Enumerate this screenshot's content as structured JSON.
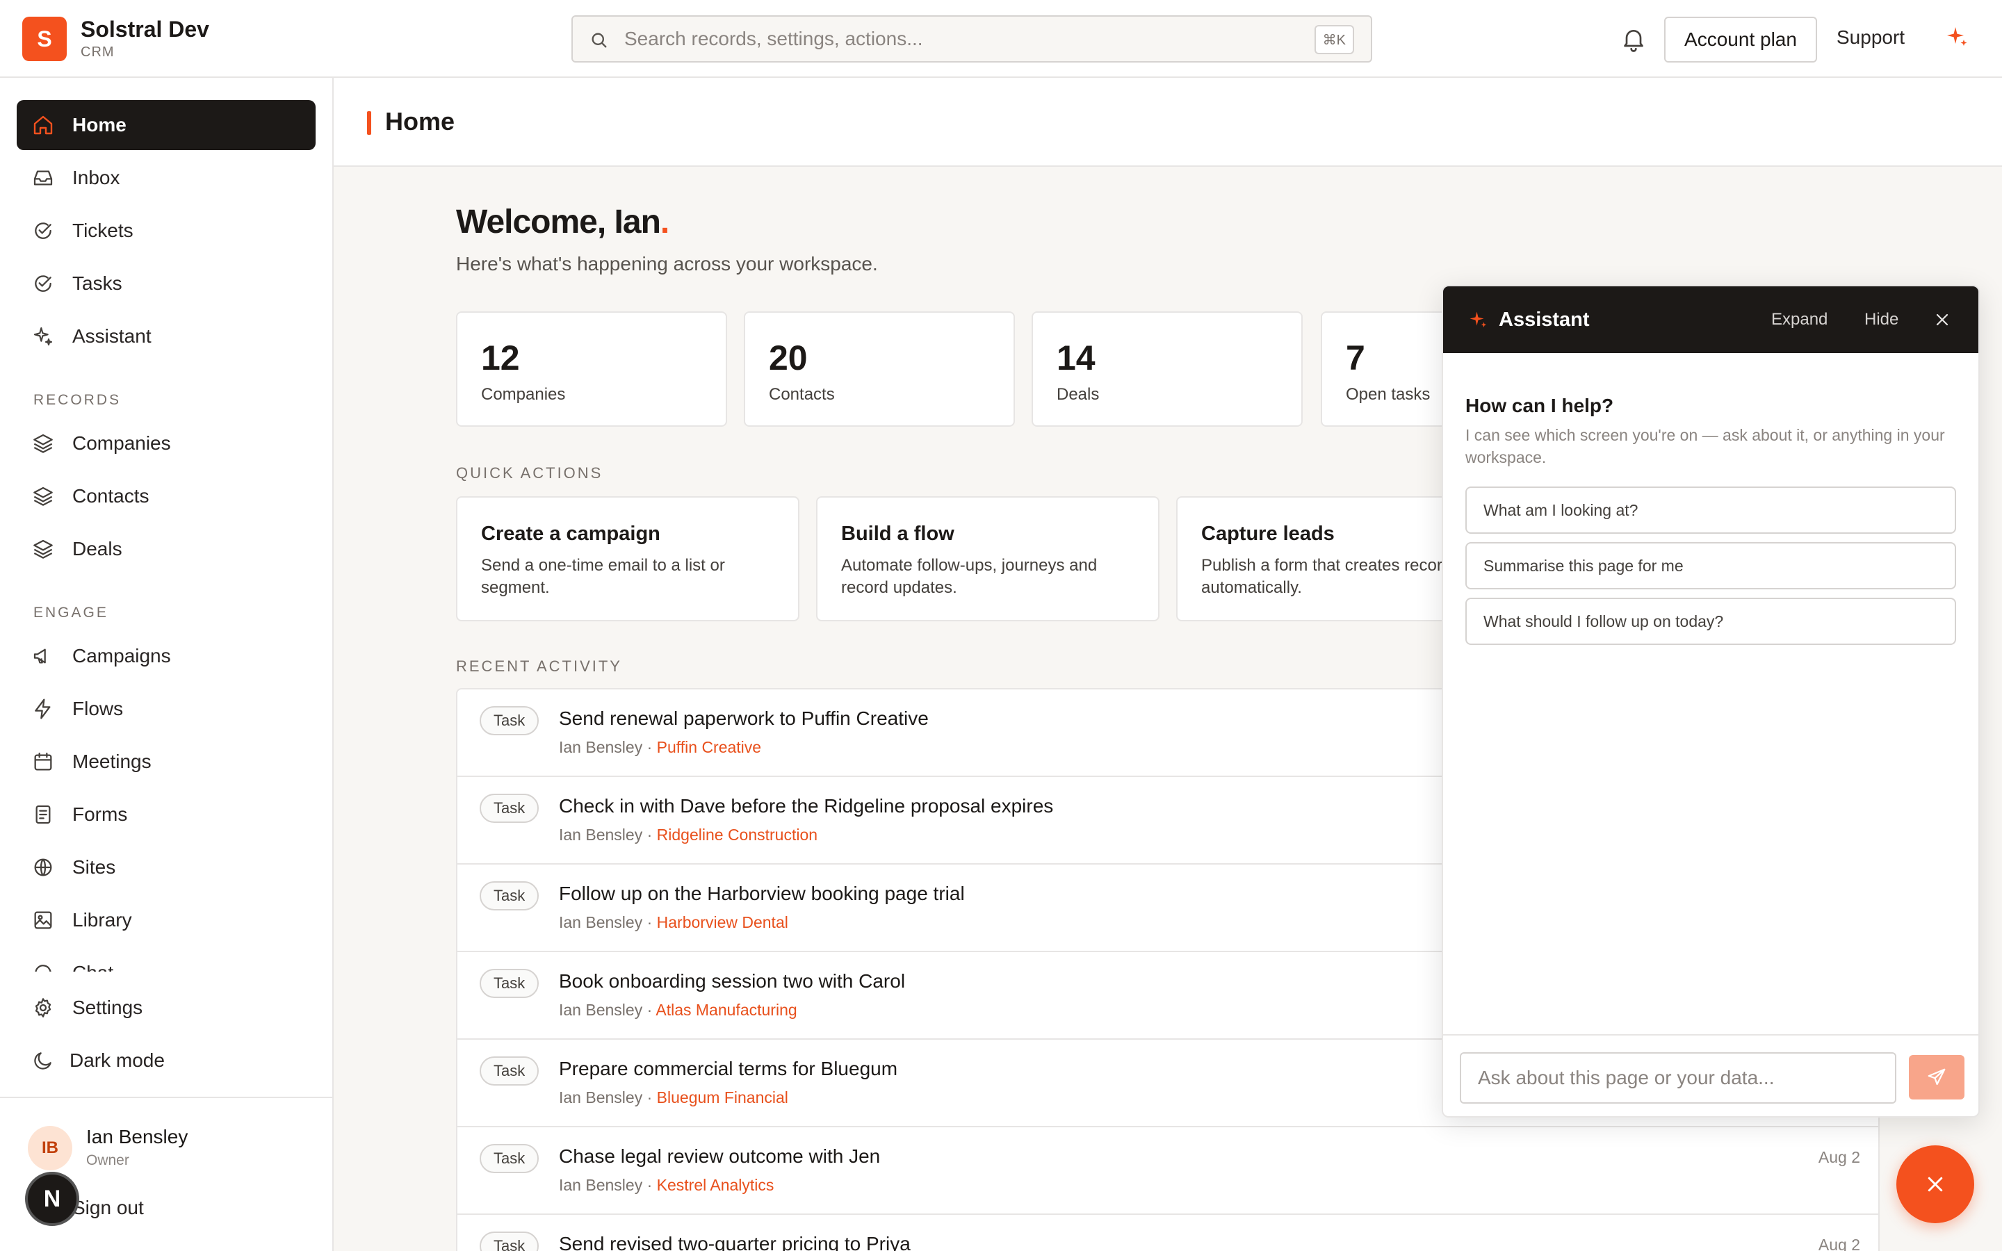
{
  "app": {
    "name": "Solstral Dev",
    "sub": "CRM",
    "logo_letter": "S"
  },
  "search": {
    "placeholder": "Search records, settings, actions...",
    "shortcut": "⌘K"
  },
  "header": {
    "account_plan": "Account plan",
    "support": "Support"
  },
  "sidebar": {
    "main": [
      {
        "label": "Home",
        "icon": "home-icon",
        "active": true
      },
      {
        "label": "Inbox",
        "icon": "inbox-icon"
      },
      {
        "label": "Tickets",
        "icon": "check-circle-icon"
      },
      {
        "label": "Tasks",
        "icon": "check-circle-icon"
      },
      {
        "label": "Assistant",
        "icon": "sparkle-icon"
      }
    ],
    "records_label": "RECORDS",
    "records": [
      {
        "label": "Companies",
        "icon": "layers-icon"
      },
      {
        "label": "Contacts",
        "icon": "layers-icon"
      },
      {
        "label": "Deals",
        "icon": "layers-icon"
      }
    ],
    "engage_label": "ENGAGE",
    "engage": [
      {
        "label": "Campaigns",
        "icon": "megaphone-icon"
      },
      {
        "label": "Flows",
        "icon": "bolt-icon"
      },
      {
        "label": "Meetings",
        "icon": "calendar-icon"
      },
      {
        "label": "Forms",
        "icon": "form-icon"
      },
      {
        "label": "Sites",
        "icon": "globe-icon"
      },
      {
        "label": "Library",
        "icon": "image-icon"
      },
      {
        "label": "Chat",
        "icon": "chat-icon"
      }
    ],
    "settings": "Settings",
    "dark_mode": "Dark mode",
    "user": {
      "initials": "IB",
      "name": "Ian Bensley",
      "role": "Owner"
    },
    "sign_out": "Sign out",
    "dev_badge": "N"
  },
  "page": {
    "title": "Home"
  },
  "welcome": {
    "heading": "Welcome, Ian",
    "dot": ".",
    "sub": "Here's what's happening across your workspace."
  },
  "stats": [
    {
      "value": "12",
      "label": "Companies"
    },
    {
      "value": "20",
      "label": "Contacts"
    },
    {
      "value": "14",
      "label": "Deals"
    },
    {
      "value": "7",
      "label": "Open tasks"
    }
  ],
  "quick_actions": {
    "label": "QUICK ACTIONS",
    "items": [
      {
        "title": "Create a campaign",
        "desc": "Send a one-time email to a list or segment."
      },
      {
        "title": "Build a flow",
        "desc": "Automate follow-ups, journeys and record updates."
      },
      {
        "title": "Capture leads",
        "desc": "Publish a form that creates records automatically."
      }
    ]
  },
  "activity": {
    "label": "RECENT ACTIVITY",
    "rows": [
      {
        "tag": "Task",
        "title": "Send renewal paperwork to Puffin Creative",
        "owner": "Ian Bensley",
        "sep": " · ",
        "company": "Puffin Creative",
        "date": ""
      },
      {
        "tag": "Task",
        "title": "Check in with Dave before the Ridgeline proposal expires",
        "owner": "Ian Bensley",
        "sep": " · ",
        "company": "Ridgeline Construction",
        "date": ""
      },
      {
        "tag": "Task",
        "title": "Follow up on the Harborview booking page trial",
        "owner": "Ian Bensley",
        "sep": " · ",
        "company": "Harborview Dental",
        "date": ""
      },
      {
        "tag": "Task",
        "title": "Book onboarding session two with Carol",
        "owner": "Ian Bensley",
        "sep": " · ",
        "company": "Atlas Manufacturing",
        "date": ""
      },
      {
        "tag": "Task",
        "title": "Prepare commercial terms for Bluegum",
        "owner": "Ian Bensley",
        "sep": " · ",
        "company": "Bluegum Financial",
        "date": ""
      },
      {
        "tag": "Task",
        "title": "Chase legal review outcome with Jen",
        "owner": "Ian Bensley",
        "sep": " · ",
        "company": "Kestrel Analytics",
        "date": "Aug 2"
      },
      {
        "tag": "Task",
        "title": "Send revised two-quarter pricing to Priya",
        "owner": "",
        "sep": "",
        "company": "",
        "date": "Aug 2"
      }
    ]
  },
  "assistant": {
    "title": "Assistant",
    "expand": "Expand",
    "hide": "Hide",
    "help_heading": "How can I help?",
    "help_desc": "I can see which screen you're on — ask about it, or anything in your workspace.",
    "suggestions": [
      "What am I looking at?",
      "Summarise this page for me",
      "What should I follow up on today?"
    ],
    "input_placeholder": "Ask about this page or your data..."
  },
  "colors": {
    "accent": "#f4511e",
    "dark": "#1c1917",
    "background": "#f8f6f3"
  }
}
